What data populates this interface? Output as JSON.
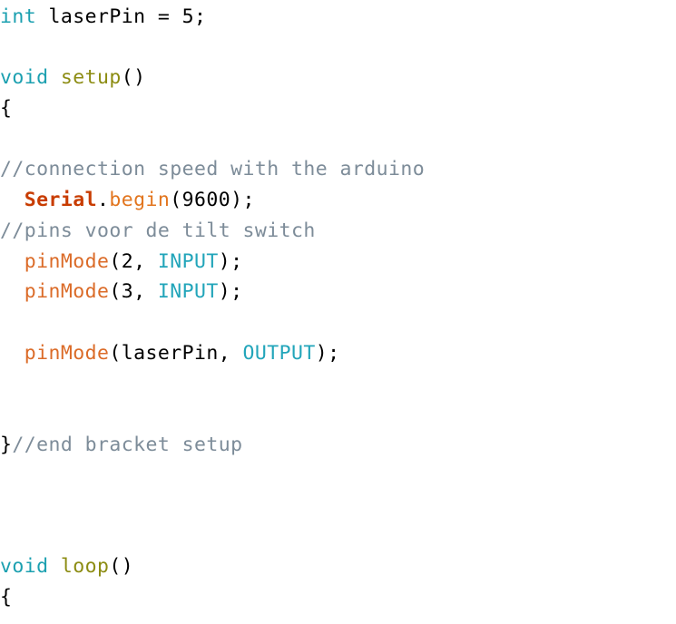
{
  "document": {
    "title": "Arduino sketch source listing",
    "language": "arduino-c",
    "background_color": "#ffffff",
    "font_size_px": 21.5,
    "line_height_px": 33.7,
    "indent_unit": "  "
  },
  "theme": {
    "plain": "#000000",
    "keyword": "#1CA0B0",
    "function": "#8C8C12",
    "comment": "#7D8C99",
    "object": "#C83C00",
    "method": "#E2751E",
    "builtin": "#DB6B28",
    "constant": "#22A5BA"
  },
  "lines": [
    {
      "number": 1,
      "text": "int laserPin = 5;",
      "tokens": [
        {
          "t": "int",
          "c": "keyword"
        },
        {
          "t": " laserPin = 5;",
          "c": "plain"
        }
      ]
    },
    {
      "number": 2,
      "text": "",
      "tokens": []
    },
    {
      "number": 3,
      "text": "void setup()",
      "tokens": [
        {
          "t": "void",
          "c": "keyword"
        },
        {
          "t": " ",
          "c": "plain"
        },
        {
          "t": "setup",
          "c": "function"
        },
        {
          "t": "()",
          "c": "plain"
        }
      ]
    },
    {
      "number": 4,
      "text": "{",
      "tokens": [
        {
          "t": "{",
          "c": "plain"
        }
      ]
    },
    {
      "number": 5,
      "text": "",
      "tokens": []
    },
    {
      "number": 6,
      "text": "//connection speed with the arduino",
      "tokens": [
        {
          "t": "//connection speed with the arduino",
          "c": "comment"
        }
      ]
    },
    {
      "number": 7,
      "text": "  Serial.begin(9600);",
      "tokens": [
        {
          "t": "  ",
          "c": "plain"
        },
        {
          "t": "Serial",
          "c": "object"
        },
        {
          "t": ".",
          "c": "plain"
        },
        {
          "t": "begin",
          "c": "method"
        },
        {
          "t": "(9600);",
          "c": "plain"
        }
      ]
    },
    {
      "number": 8,
      "text": "//pins voor de tilt switch",
      "tokens": [
        {
          "t": "//pins voor de tilt switch",
          "c": "comment"
        }
      ]
    },
    {
      "number": 9,
      "text": "  pinMode(2, INPUT);",
      "tokens": [
        {
          "t": "  ",
          "c": "plain"
        },
        {
          "t": "pinMode",
          "c": "builtin"
        },
        {
          "t": "(2, ",
          "c": "plain"
        },
        {
          "t": "INPUT",
          "c": "constant"
        },
        {
          "t": ");",
          "c": "plain"
        }
      ]
    },
    {
      "number": 10,
      "text": "  pinMode(3, INPUT);",
      "tokens": [
        {
          "t": "  ",
          "c": "plain"
        },
        {
          "t": "pinMode",
          "c": "builtin"
        },
        {
          "t": "(3, ",
          "c": "plain"
        },
        {
          "t": "INPUT",
          "c": "constant"
        },
        {
          "t": ");",
          "c": "plain"
        }
      ]
    },
    {
      "number": 11,
      "text": "",
      "tokens": []
    },
    {
      "number": 12,
      "text": "  pinMode(laserPin, OUTPUT);",
      "tokens": [
        {
          "t": "  ",
          "c": "plain"
        },
        {
          "t": "pinMode",
          "c": "builtin"
        },
        {
          "t": "(laserPin, ",
          "c": "plain"
        },
        {
          "t": "OUTPUT",
          "c": "constant"
        },
        {
          "t": ");",
          "c": "plain"
        }
      ]
    },
    {
      "number": 13,
      "text": "",
      "tokens": []
    },
    {
      "number": 14,
      "text": "",
      "tokens": []
    },
    {
      "number": 15,
      "text": "}//end bracket setup",
      "tokens": [
        {
          "t": "}",
          "c": "plain"
        },
        {
          "t": "//end bracket setup",
          "c": "comment"
        }
      ]
    },
    {
      "number": 16,
      "text": "",
      "tokens": []
    },
    {
      "number": 17,
      "text": "",
      "tokens": []
    },
    {
      "number": 18,
      "text": "",
      "tokens": []
    },
    {
      "number": 19,
      "text": "void loop()",
      "tokens": [
        {
          "t": "void",
          "c": "keyword"
        },
        {
          "t": " ",
          "c": "plain"
        },
        {
          "t": "loop",
          "c": "function"
        },
        {
          "t": "()",
          "c": "plain"
        }
      ]
    },
    {
      "number": 20,
      "text": "{",
      "tokens": [
        {
          "t": "{",
          "c": "plain"
        }
      ]
    }
  ]
}
